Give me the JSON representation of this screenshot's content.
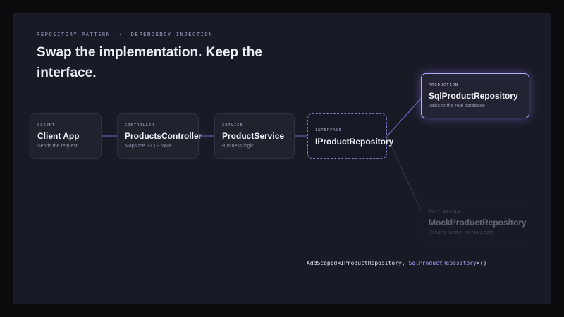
{
  "header": {
    "eyebrow": "REPOSITORY PATTERN  ·  DEPENDENCY INJECTION",
    "headline": "Swap the implementation. Keep the interface."
  },
  "nodes": {
    "client": {
      "kicker": "CLIENT",
      "title": "Client App",
      "desc": "Sends the request"
    },
    "controller": {
      "kicker": "CONTROLLER",
      "title": "ProductsController",
      "desc": "Maps the HTTP route"
    },
    "service": {
      "kicker": "SERVICE",
      "title": "ProductService",
      "desc": "Business logic"
    },
    "interface": {
      "kicker": "INTERFACE",
      "title": "IProductRepository"
    },
    "production": {
      "kicker": "PRODUCTION",
      "title": "SqlProductRepository",
      "desc": "Talks to the real database",
      "state": "active"
    },
    "test": {
      "kicker": "TEST DOUBLE",
      "title": "MockProductRepository",
      "desc": "Returns fixed in-memory data",
      "state": "inactive"
    }
  },
  "registration": {
    "prefix": "AddScoped<IProductRepository, ",
    "implementation": "SqlProductRepository",
    "suffix": ">()"
  },
  "colors": {
    "background": "#181a26",
    "accent": "#b3a9ff",
    "connector": "#5a5ca8",
    "code_accent": "#a39cf2"
  }
}
